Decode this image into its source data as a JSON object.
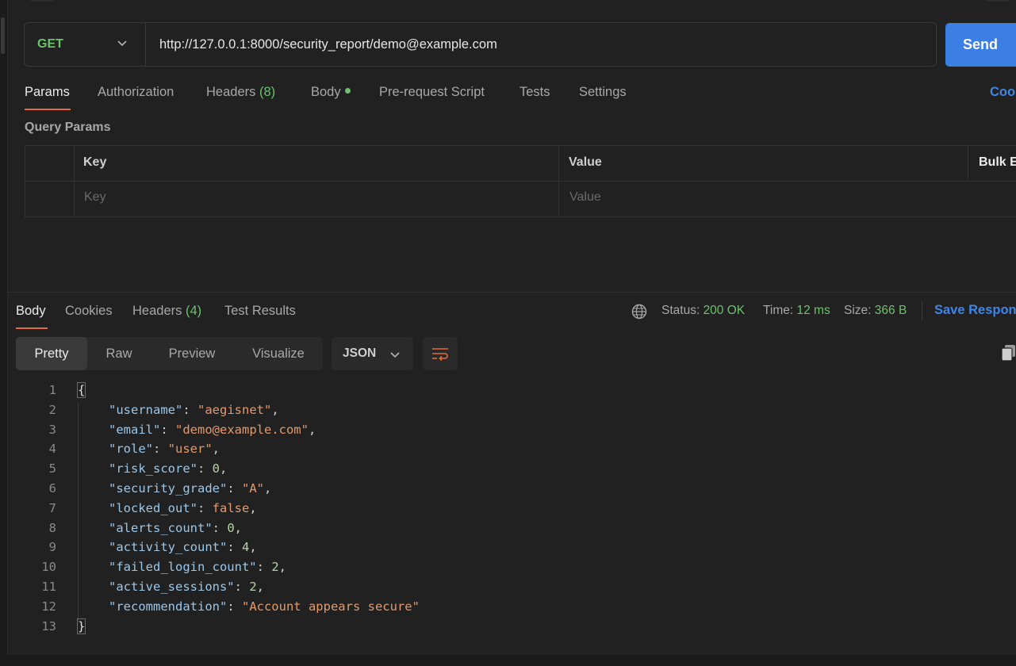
{
  "request": {
    "method": "GET",
    "url": "http://127.0.0.1:8000/security_report/demo@example.com",
    "send_label": "Send"
  },
  "request_tabs": {
    "params": "Params",
    "authorization": "Authorization",
    "headers": "Headers",
    "headers_count": "(8)",
    "body": "Body",
    "prerequest": "Pre-request Script",
    "tests": "Tests",
    "settings": "Settings",
    "cookies": "Coo"
  },
  "query_params": {
    "title": "Query Params",
    "key_header": "Key",
    "value_header": "Value",
    "bulk_edit": "Bulk E",
    "key_placeholder": "Key",
    "value_placeholder": "Value"
  },
  "response_tabs": {
    "body": "Body",
    "cookies": "Cookies",
    "headers": "Headers",
    "headers_count": "(4)",
    "test_results": "Test Results"
  },
  "response_meta": {
    "status_label": "Status:",
    "status_value": "200 OK",
    "time_label": "Time:",
    "time_value": "12 ms",
    "size_label": "Size:",
    "size_value": "366 B",
    "save_response": "Save Respon"
  },
  "view_modes": {
    "pretty": "Pretty",
    "raw": "Raw",
    "preview": "Preview",
    "visualize": "Visualize",
    "format": "JSON"
  },
  "response_body": {
    "open_brace": "{",
    "close_brace": "}",
    "entries": [
      {
        "key": "\"username\"",
        "value": "\"aegisnet\"",
        "type": "string",
        "comma": ","
      },
      {
        "key": "\"email\"",
        "value": "\"demo@example.com\"",
        "type": "string",
        "comma": ","
      },
      {
        "key": "\"role\"",
        "value": "\"user\"",
        "type": "string",
        "comma": ","
      },
      {
        "key": "\"risk_score\"",
        "value": "0",
        "type": "number",
        "comma": ","
      },
      {
        "key": "\"security_grade\"",
        "value": "\"A\"",
        "type": "string",
        "comma": ","
      },
      {
        "key": "\"locked_out\"",
        "value": "false",
        "type": "boolean",
        "comma": ","
      },
      {
        "key": "\"alerts_count\"",
        "value": "0",
        "type": "number",
        "comma": ","
      },
      {
        "key": "\"activity_count\"",
        "value": "4",
        "type": "number",
        "comma": ","
      },
      {
        "key": "\"failed_login_count\"",
        "value": "2",
        "type": "number",
        "comma": ","
      },
      {
        "key": "\"active_sessions\"",
        "value": "2",
        "type": "number",
        "comma": ","
      },
      {
        "key": "\"recommendation\"",
        "value": "\"Account appears secure\"",
        "type": "string",
        "comma": ""
      }
    ],
    "line_numbers": [
      "1",
      "2",
      "3",
      "4",
      "5",
      "6",
      "7",
      "8",
      "9",
      "10",
      "11",
      "12",
      "13"
    ]
  },
  "colors": {
    "accent": "#e46a3c",
    "send_button": "#3b7fe4",
    "link": "#3d86ea",
    "success": "#6cc26c",
    "method_get": "#6cc26c"
  },
  "icons": {
    "method_dropdown": "chevron-down-icon",
    "globe": "globe-icon",
    "format_dropdown": "chevron-down-icon",
    "wrap": "wrap-lines-icon",
    "copy": "copy-icon"
  }
}
